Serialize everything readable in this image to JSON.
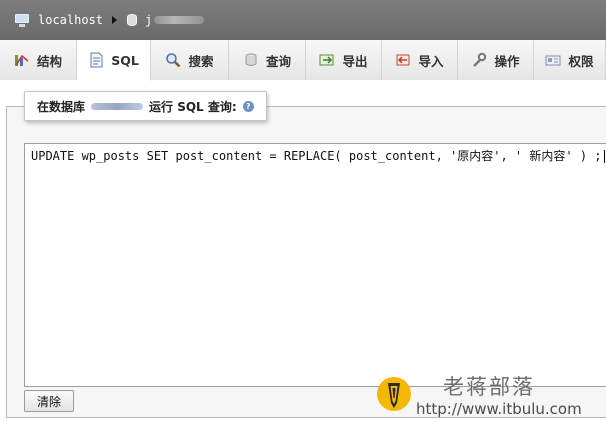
{
  "breadcrumb": {
    "server": "localhost",
    "database_prefix": "j"
  },
  "tabs": [
    {
      "label": "结构",
      "icon": "structure-icon"
    },
    {
      "label": "SQL",
      "icon": "sql-icon"
    },
    {
      "label": "搜索",
      "icon": "search-icon"
    },
    {
      "label": "查询",
      "icon": "query-icon"
    },
    {
      "label": "导出",
      "icon": "export-icon"
    },
    {
      "label": "导入",
      "icon": "import-icon"
    },
    {
      "label": "操作",
      "icon": "wrench-icon"
    },
    {
      "label": "权限",
      "icon": "privileges-icon"
    }
  ],
  "active_tab": "SQL",
  "legend": {
    "prefix": "在数据库",
    "suffix": "运行 SQL 查询:"
  },
  "editor": {
    "query": "UPDATE wp_posts SET post_content = REPLACE( post_content, '原内容', ' 新内容' ) ;"
  },
  "clear_button": "清除",
  "watermark": {
    "title": "老蒋部落",
    "url": "http://www.itbulu.com"
  },
  "colors": {
    "topbar": "#737373",
    "tab_bg": "#ededed",
    "help_icon": "#6f8fc4"
  }
}
